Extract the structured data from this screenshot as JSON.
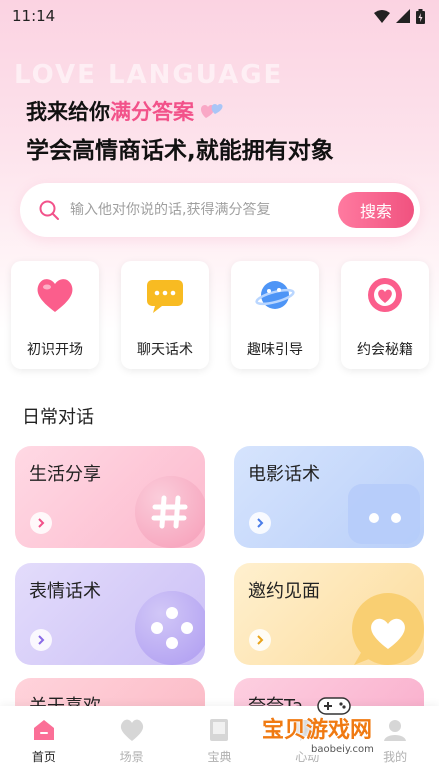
{
  "status_bar": {
    "time": "11:14"
  },
  "hero": {
    "bg_word": "LOVE LANGUAGE",
    "line1_prefix": "我来给你",
    "line1_accent": "满分答案",
    "line2": "学会高情商话术,就能拥有对象"
  },
  "search": {
    "placeholder": "输入他对你说的话,获得满分答复",
    "button_label": "搜索"
  },
  "categories": [
    {
      "label": "初识开场",
      "icon": "heart-icon"
    },
    {
      "label": "聊天话术",
      "icon": "chat-bubble-icon"
    },
    {
      "label": "趣味引导",
      "icon": "planet-icon"
    },
    {
      "label": "约会秘籍",
      "icon": "heart-ring-icon"
    }
  ],
  "section_title": "日常对话",
  "cards": [
    {
      "title": "生活分享",
      "icon": "hash-icon",
      "color": "#fdc9d8"
    },
    {
      "title": "电影话术",
      "icon": "dots-icon",
      "color": "#c6d8fb"
    },
    {
      "title": "表情话术",
      "icon": "grid-dots-icon",
      "color": "#d6cdf8"
    },
    {
      "title": "邀约见面",
      "icon": "heart-bubble-icon",
      "color": "#fde4b2"
    },
    {
      "title": "关于喜欢",
      "icon": "",
      "color": "#fcc2cc"
    },
    {
      "title": "夸夸Ta",
      "icon": "",
      "color": "#fbbcd6"
    }
  ],
  "tabbar": [
    {
      "label": "首页",
      "icon": "home-icon",
      "active": true
    },
    {
      "label": "场景",
      "icon": "heart-icon",
      "active": false
    },
    {
      "label": "宝典",
      "icon": "book-icon",
      "active": false
    },
    {
      "label": "心动",
      "icon": "chat-icon",
      "active": false
    },
    {
      "label": "我的",
      "icon": "user-icon",
      "active": false
    }
  ],
  "watermark": {
    "text": "宝贝游戏网",
    "url": "baobeiy.com"
  }
}
